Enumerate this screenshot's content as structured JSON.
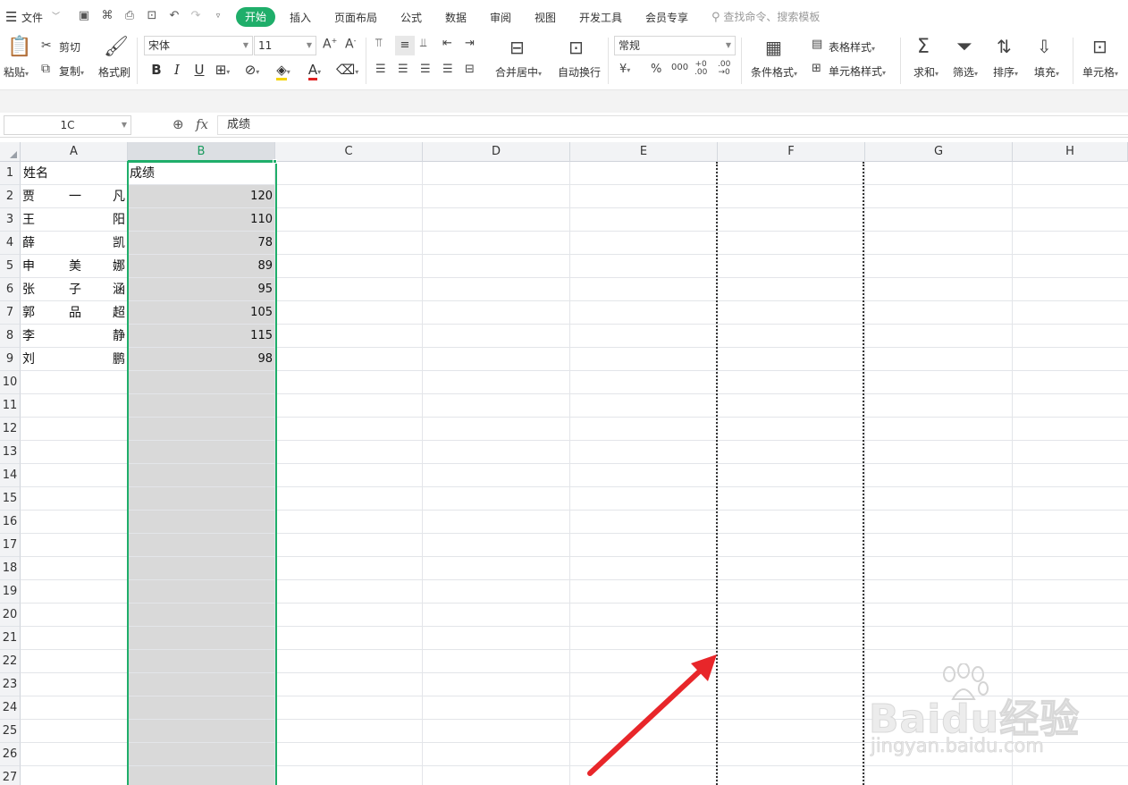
{
  "menu": {
    "file": "文件",
    "tabs": [
      "开始",
      "插入",
      "页面布局",
      "公式",
      "数据",
      "审阅",
      "视图",
      "开发工具",
      "会员专享"
    ],
    "search_placeholder": "查找命令、搜索模板"
  },
  "ribbon": {
    "paste": "粘贴",
    "cut": "剪切",
    "copy": "复制",
    "format_painter": "格式刷",
    "font_name": "宋体",
    "font_size": "11",
    "merge_center": "合并居中",
    "wrap_text": "自动换行",
    "number_format": "常规",
    "conditional_format": "条件格式",
    "table_style": "表格样式",
    "cell_style": "单元格样式",
    "sum": "求和",
    "filter": "筛选",
    "sort": "排序",
    "fill": "填充",
    "cell": "单元格"
  },
  "formula_bar": {
    "name_box": "1C",
    "fx": "fx",
    "content": "成绩"
  },
  "columns": [
    "A",
    "B",
    "C",
    "D",
    "E",
    "F",
    "G",
    "H"
  ],
  "rows": [
    "1",
    "2",
    "3",
    "4",
    "5",
    "6",
    "7",
    "8",
    "9",
    "10",
    "11",
    "12",
    "13",
    "14",
    "15",
    "16",
    "17",
    "18",
    "19",
    "20",
    "21",
    "22",
    "23",
    "24",
    "25",
    "26",
    "27"
  ],
  "sheet": {
    "header_a": "姓名",
    "header_b": "成绩",
    "names": [
      [
        "贾",
        "一",
        "凡"
      ],
      [
        "王",
        "",
        "阳"
      ],
      [
        "薛",
        "",
        "凯"
      ],
      [
        "申",
        "美",
        "娜"
      ],
      [
        "张",
        "子",
        "涵"
      ],
      [
        "郭",
        "品",
        "超"
      ],
      [
        "李",
        "",
        "静"
      ],
      [
        "刘",
        "",
        "鹏"
      ]
    ],
    "scores": [
      "120",
      "110",
      "78",
      "89",
      "95",
      "105",
      "115",
      "98"
    ]
  },
  "selection": {
    "column": "B",
    "copy_marquee_column": "F"
  },
  "watermark": {
    "main": "Baidu经验",
    "sub": "jingyan.baidu.com"
  },
  "colors": {
    "accent": "#1fae6a",
    "selection_fill": "#d9d9d9",
    "arrow": "#e8262a"
  }
}
